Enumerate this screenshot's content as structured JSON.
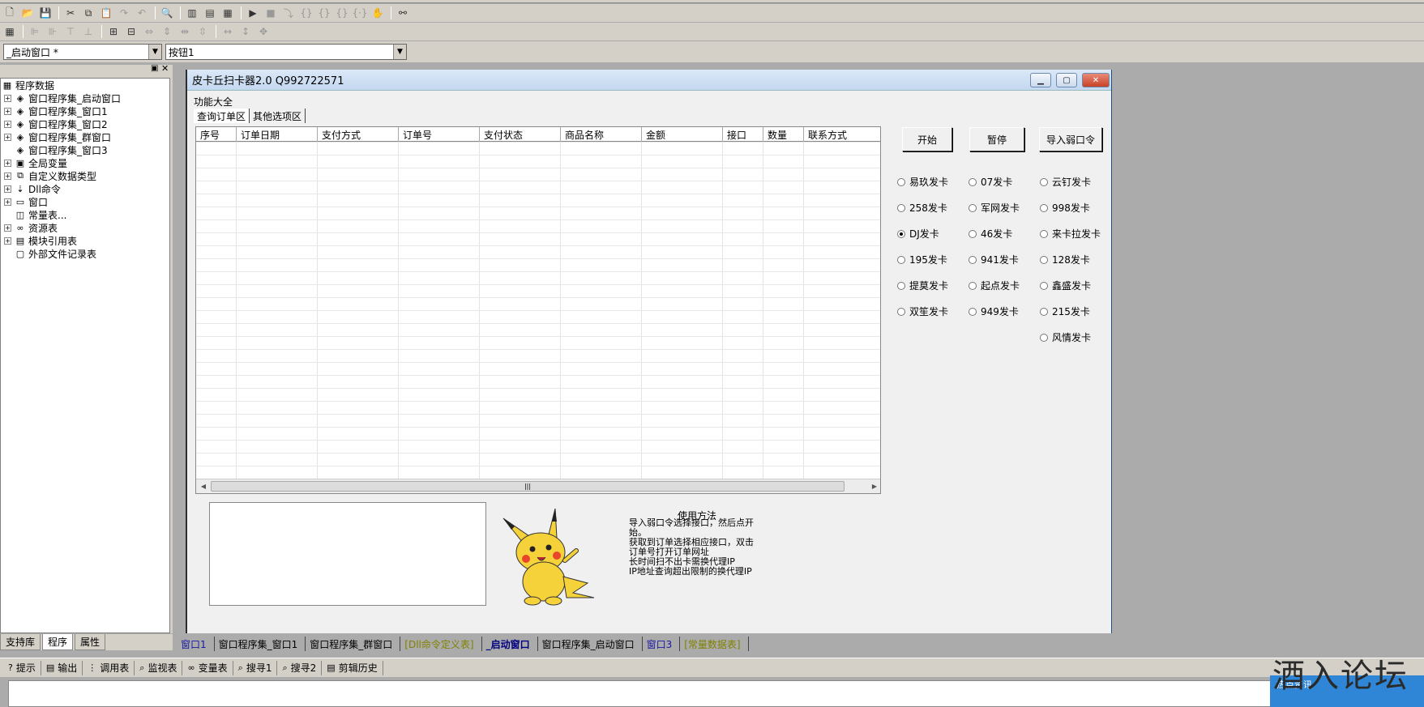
{
  "toolbar2": {
    "window_combo": "_启动窗口 *",
    "control_combo": "按钮1"
  },
  "tree": {
    "items": [
      {
        "label": "程序数据",
        "icon": "▦",
        "pm": "",
        "indent": 0
      },
      {
        "label": "窗口程序集_启动窗口",
        "icon": "◈",
        "pm": "+",
        "indent": 1
      },
      {
        "label": "窗口程序集_窗口1",
        "icon": "◈",
        "pm": "+",
        "indent": 1
      },
      {
        "label": "窗口程序集_窗口2",
        "icon": "◈",
        "pm": "+",
        "indent": 1
      },
      {
        "label": "窗口程序集_群窗口",
        "icon": "◈",
        "pm": "+",
        "indent": 1
      },
      {
        "label": "窗口程序集_窗口3",
        "icon": "◈",
        "pm": "",
        "indent": 1
      },
      {
        "label": "全局变量",
        "icon": "▣",
        "pm": "+",
        "indent": 1
      },
      {
        "label": "自定义数据类型",
        "icon": "⧉",
        "pm": "+",
        "indent": 1
      },
      {
        "label": "Dll命令",
        "icon": "⇣",
        "pm": "+",
        "indent": 1
      },
      {
        "label": "窗口",
        "icon": "▭",
        "pm": "+",
        "indent": 1
      },
      {
        "label": "常量表...",
        "icon": "◫",
        "pm": "",
        "indent": 1
      },
      {
        "label": "资源表",
        "icon": "∞",
        "pm": "+",
        "indent": 1
      },
      {
        "label": "模块引用表",
        "icon": "▤",
        "pm": "+",
        "indent": 1
      },
      {
        "label": "外部文件记录表",
        "icon": "▢",
        "pm": "",
        "indent": 1
      }
    ]
  },
  "left_tabs": [
    "支持库",
    "程序",
    "属性"
  ],
  "window": {
    "title": "皮卡丘扫卡器2.0  Q992722571",
    "menu": "功能大全",
    "tabs": [
      "查询订单区",
      "其他选项区"
    ]
  },
  "grid": {
    "columns": [
      "序号",
      "订单日期",
      "支付方式",
      "订单号",
      "支付状态",
      "商品名称",
      "金额",
      "接口",
      "数量",
      "联系方式"
    ]
  },
  "buttons": {
    "start": "开始",
    "pause": "暂停",
    "import": "导入弱口令"
  },
  "radios": [
    [
      "易玖发卡",
      "07发卡",
      "云钉发卡"
    ],
    [
      "258发卡",
      "军网发卡",
      "998发卡"
    ],
    [
      "DJ发卡",
      "46发卡",
      "来卡拉发卡"
    ],
    [
      "195发卡",
      "941发卡",
      "128发卡"
    ],
    [
      "提莫发卡",
      "起点发卡",
      "鑫盛发卡"
    ],
    [
      "双笙发卡",
      "949发卡",
      "215发卡"
    ],
    [
      "",
      "",
      "风情发卡"
    ]
  ],
  "radio_selected": "DJ发卡",
  "usage": {
    "title": "使用方法",
    "text": "导入弱口令选择接口，然后点开\n始。\n获取到订单选择相应接口，双击\n订单号打开订单网址\n长时间扫不出卡需换代理IP\nIP地址查询超出限制的换代理IP"
  },
  "doc_tabs": [
    {
      "label": "窗口1",
      "style": "blue"
    },
    {
      "label": "窗口程序集_窗口1",
      "style": ""
    },
    {
      "label": "窗口程序集_群窗口",
      "style": ""
    },
    {
      "label": "[Dll命令定义表]",
      "style": "olive"
    },
    {
      "label": "_启动窗口",
      "style": "active"
    },
    {
      "label": "窗口程序集_启动窗口",
      "style": ""
    },
    {
      "label": "窗口3",
      "style": "blue"
    },
    {
      "label": "[常量数据表]",
      "style": "olive"
    }
  ],
  "bottom_tabs": [
    {
      "label": "提示",
      "icon": "?"
    },
    {
      "label": "输出",
      "icon": "▤"
    },
    {
      "label": "调用表",
      "icon": "⋮"
    },
    {
      "label": "监视表",
      "icon": "⌕"
    },
    {
      "label": "变量表",
      "icon": "∞"
    },
    {
      "label": "搜寻1",
      "icon": "⌕"
    },
    {
      "label": "搜寻2",
      "icon": "⌕"
    },
    {
      "label": "剪辑历史",
      "icon": "▤"
    }
  ],
  "watermark": "酒入论坛",
  "hotnews": "热点资讯"
}
